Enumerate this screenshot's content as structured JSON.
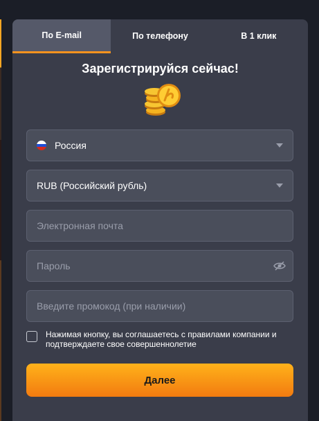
{
  "tabs": [
    "По E-mail",
    "По телефону",
    "В 1 клик"
  ],
  "title": "Зарегистрируйся сейчас!",
  "form": {
    "country": {
      "value": "Россия",
      "icon": "russia-flag-icon"
    },
    "currency": {
      "value": "RUB (Российский рубль)"
    },
    "email": {
      "placeholder": "Электронная почта"
    },
    "password": {
      "placeholder": "Пароль",
      "icon": "eye-slash-icon"
    },
    "promo": {
      "placeholder": "Введите промокод (при наличии)"
    },
    "agree_text": "Нажимая кнопку, вы соглашаетесь с правилами компании и подтверждаете свое совершеннолетие",
    "submit_label": "Далее"
  },
  "colors": {
    "accent": "#f7931e",
    "panel": "#3a3d4a",
    "field": "#4a4e5b"
  }
}
